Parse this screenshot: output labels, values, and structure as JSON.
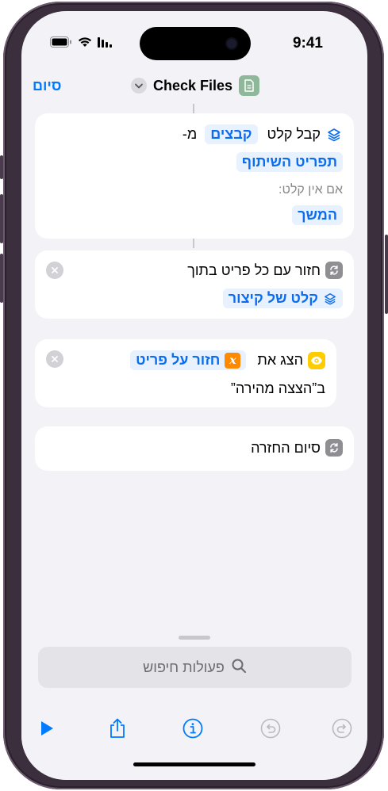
{
  "status_bar": {
    "time": "9:41"
  },
  "nav": {
    "done_label": "סיום",
    "title": "Check Files"
  },
  "actions": {
    "receive": {
      "verb": "קבל קלט",
      "types_token": "קבצים",
      "from_label": "מ-",
      "source_token": "תפריט השיתוף",
      "if_no_input_label": "אם אין קלט:",
      "fallback_token": "המשך"
    },
    "repeat": {
      "label": "חזור עם כל פריט בתוך",
      "input_token": "קלט של קיצור"
    },
    "show": {
      "label": "הצג את",
      "variable_token": "חזור על פריט",
      "variable_glyph": "x",
      "suffix": "ב”הצצה מהירה”"
    },
    "end_repeat": {
      "label": "סיום החזרה"
    }
  },
  "sheet": {
    "search_placeholder": "פעולות חיפוש"
  },
  "toolbar": {
    "icons": [
      "play-icon",
      "share-icon",
      "info-icon",
      "undo-icon",
      "redo-icon"
    ]
  },
  "colors": {
    "accent": "#007aff",
    "token_bg": "#e8f1fe",
    "token_text": "#0a6cf0",
    "screen_bg": "#f2f2f7",
    "variable_orange": "#ff8a00",
    "quicklook_yellow": "#ffcc00"
  }
}
